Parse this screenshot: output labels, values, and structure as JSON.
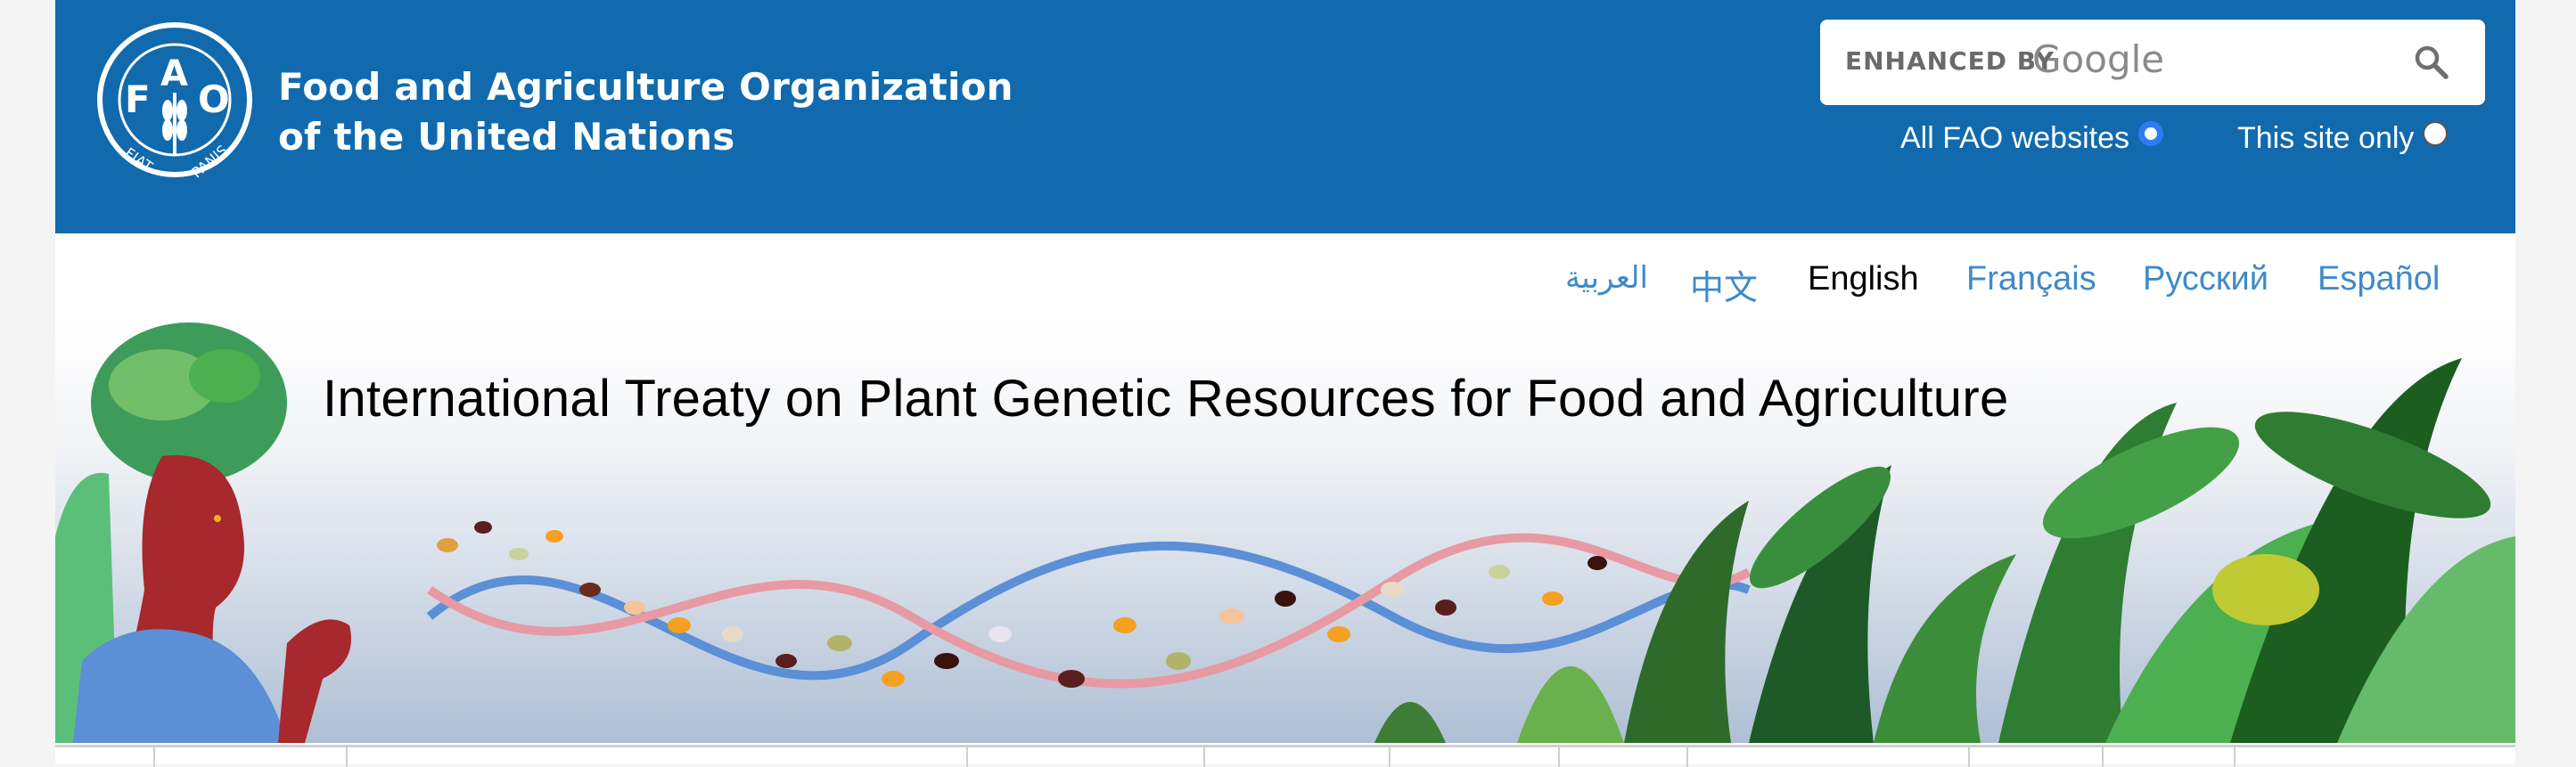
{
  "header": {
    "org_name_line1": "Food and Agriculture Organization",
    "org_name_line2": "of the United Nations",
    "logo_text": "FAO",
    "logo_motto": "FIAT PANIS",
    "bg_color": "#116aad"
  },
  "search": {
    "enhanced_by": "ENHANCED BY",
    "google_label": "Google",
    "value": "",
    "icon": "search-icon"
  },
  "scope": {
    "all_label": "All FAO websites",
    "all_checked": true,
    "site_label": "This site only",
    "site_checked": false,
    "accent_color": "#2f7bf3"
  },
  "languages": [
    {
      "label": "العربية",
      "current": false
    },
    {
      "label": "中文",
      "current": false
    },
    {
      "label": "English",
      "current": true
    },
    {
      "label": "Français",
      "current": false
    },
    {
      "label": "Русский",
      "current": false
    },
    {
      "label": "Español",
      "current": false
    }
  ],
  "banner": {
    "title": "International Treaty on Plant Genetic Resources for Food and Agriculture"
  },
  "colors": {
    "link": "#3f8ac9",
    "page_bg": "#f4f4f4"
  }
}
